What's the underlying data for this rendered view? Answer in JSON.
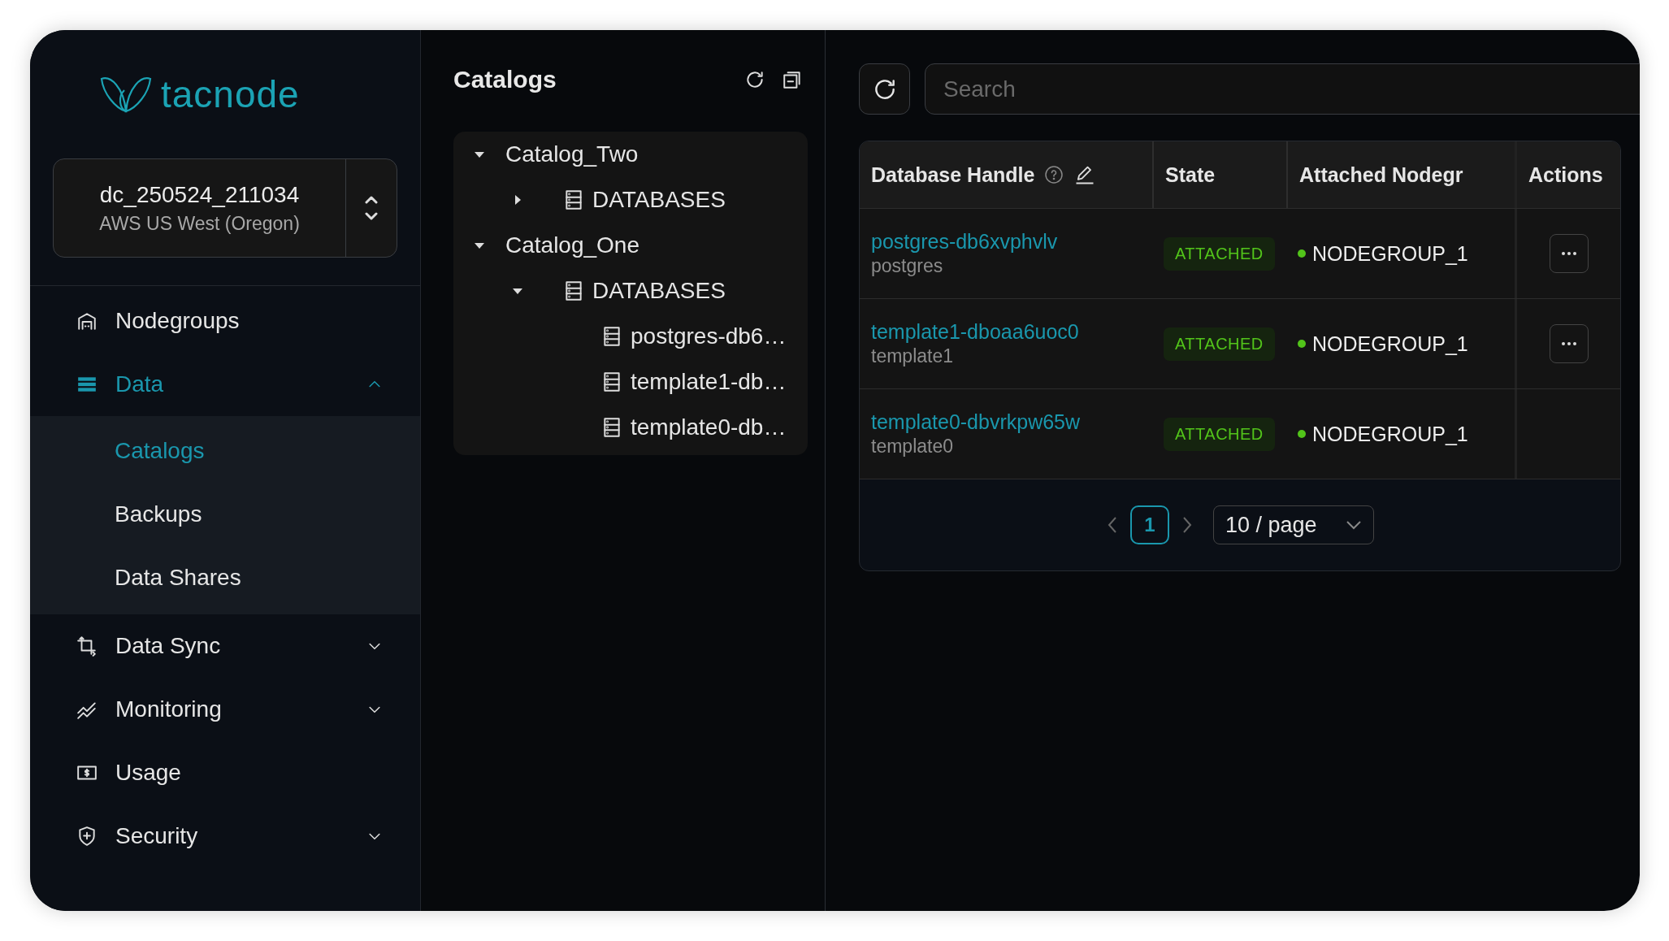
{
  "logo": {
    "text": "tacnode"
  },
  "cluster_selector": {
    "name": "dc_250524_211034",
    "region": "AWS US West (Oregon)"
  },
  "sidebar": {
    "items": [
      {
        "label": "Nodegroups",
        "kind": "link",
        "selected": false
      },
      {
        "label": "Data",
        "kind": "group",
        "selected": true,
        "expanded": true,
        "children": [
          {
            "label": "Catalogs",
            "selected": true
          },
          {
            "label": "Backups",
            "selected": false
          },
          {
            "label": "Data Shares",
            "selected": false
          }
        ]
      },
      {
        "label": "Data Sync",
        "kind": "group",
        "selected": false,
        "expanded": false
      },
      {
        "label": "Monitoring",
        "kind": "group",
        "selected": false,
        "expanded": false
      },
      {
        "label": "Usage",
        "kind": "link",
        "selected": false
      },
      {
        "label": "Security",
        "kind": "group",
        "selected": false,
        "expanded": false
      }
    ]
  },
  "catalog_panel": {
    "title": "Catalogs",
    "tree": [
      {
        "label": "Catalog_Two",
        "kind": "catalog",
        "expanded": true,
        "children": [
          {
            "label": "DATABASES",
            "kind": "folder",
            "expanded": false
          }
        ]
      },
      {
        "label": "Catalog_One",
        "kind": "catalog",
        "expanded": true,
        "children": [
          {
            "label": "DATABASES",
            "kind": "folder",
            "expanded": true,
            "children": [
              {
                "label": "postgres-db6…",
                "kind": "database"
              },
              {
                "label": "template1-db…",
                "kind": "database"
              },
              {
                "label": "template0-db…",
                "kind": "database"
              }
            ]
          }
        ]
      }
    ]
  },
  "search": {
    "placeholder": "Search"
  },
  "table": {
    "columns": [
      "Database Handle",
      "State",
      "Attached Nodegr",
      "Actions"
    ],
    "rows": [
      {
        "handle": "postgres-db6xvphvlv",
        "name": "postgres",
        "state": "ATTACHED",
        "nodegroup": "NODEGROUP_1",
        "color": "#52c41a",
        "actions": true
      },
      {
        "handle": "template1-dboaa6uoc0",
        "name": "template1",
        "state": "ATTACHED",
        "nodegroup": "NODEGROUP_1",
        "color": "#52c41a",
        "actions": true
      },
      {
        "handle": "template0-dbvrkpw65w",
        "name": "template0",
        "state": "ATTACHED",
        "nodegroup": "NODEGROUP_1",
        "color": "#52c41a",
        "actions": false
      }
    ]
  },
  "pagination": {
    "pages": [
      {
        "label": "1",
        "selected": true
      }
    ],
    "page_size": "10 / page"
  }
}
